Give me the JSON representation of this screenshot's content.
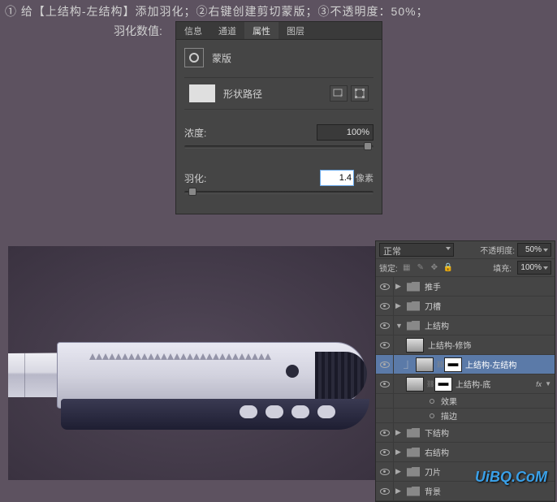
{
  "instruction": "① 给【上结构-左结构】添加羽化；②右键创建剪切蒙版；③不透明度：50%；",
  "featherLabel": "羽化数值:",
  "propsPanel": {
    "tabs": [
      "信息",
      "通道",
      "属性",
      "图层"
    ],
    "activeTab": 2,
    "maskLabel": "蒙版",
    "shapePathLabel": "形状路径",
    "density": {
      "label": "浓度:",
      "value": "100%",
      "pos": 95
    },
    "feather": {
      "label": "羽化:",
      "value": "1.4",
      "suffix": "像素",
      "pos": 2
    }
  },
  "layersPanel": {
    "blendMode": "正常",
    "opacityLabel": "不透明度:",
    "opacity": "50%",
    "lockLabel": "锁定:",
    "fillLabel": "填充:",
    "fill": "100%",
    "layers": [
      {
        "type": "group",
        "name": "推手",
        "indent": 0,
        "open": false
      },
      {
        "type": "group",
        "name": "刀槽",
        "indent": 0,
        "open": false
      },
      {
        "type": "group",
        "name": "上结构",
        "indent": 0,
        "open": true
      },
      {
        "type": "shape",
        "name": "上结构-修饰",
        "indent": 1
      },
      {
        "type": "shape",
        "name": "上结构-左结构",
        "indent": 1,
        "selected": true,
        "clip": true,
        "mask": true
      },
      {
        "type": "shape",
        "name": "上结构-底",
        "indent": 1,
        "mask": true,
        "fx": true
      },
      {
        "type": "fx",
        "name": "效果",
        "indent": 2
      },
      {
        "type": "fx",
        "name": "描边",
        "indent": 2
      },
      {
        "type": "group",
        "name": "下结构",
        "indent": 0,
        "open": false
      },
      {
        "type": "group",
        "name": "右结构",
        "indent": 0,
        "open": false
      },
      {
        "type": "group",
        "name": "刀片",
        "indent": 0,
        "open": false
      },
      {
        "type": "group",
        "name": "背景",
        "indent": 0,
        "open": false
      }
    ]
  },
  "watermark": "UiBQ.CoM"
}
